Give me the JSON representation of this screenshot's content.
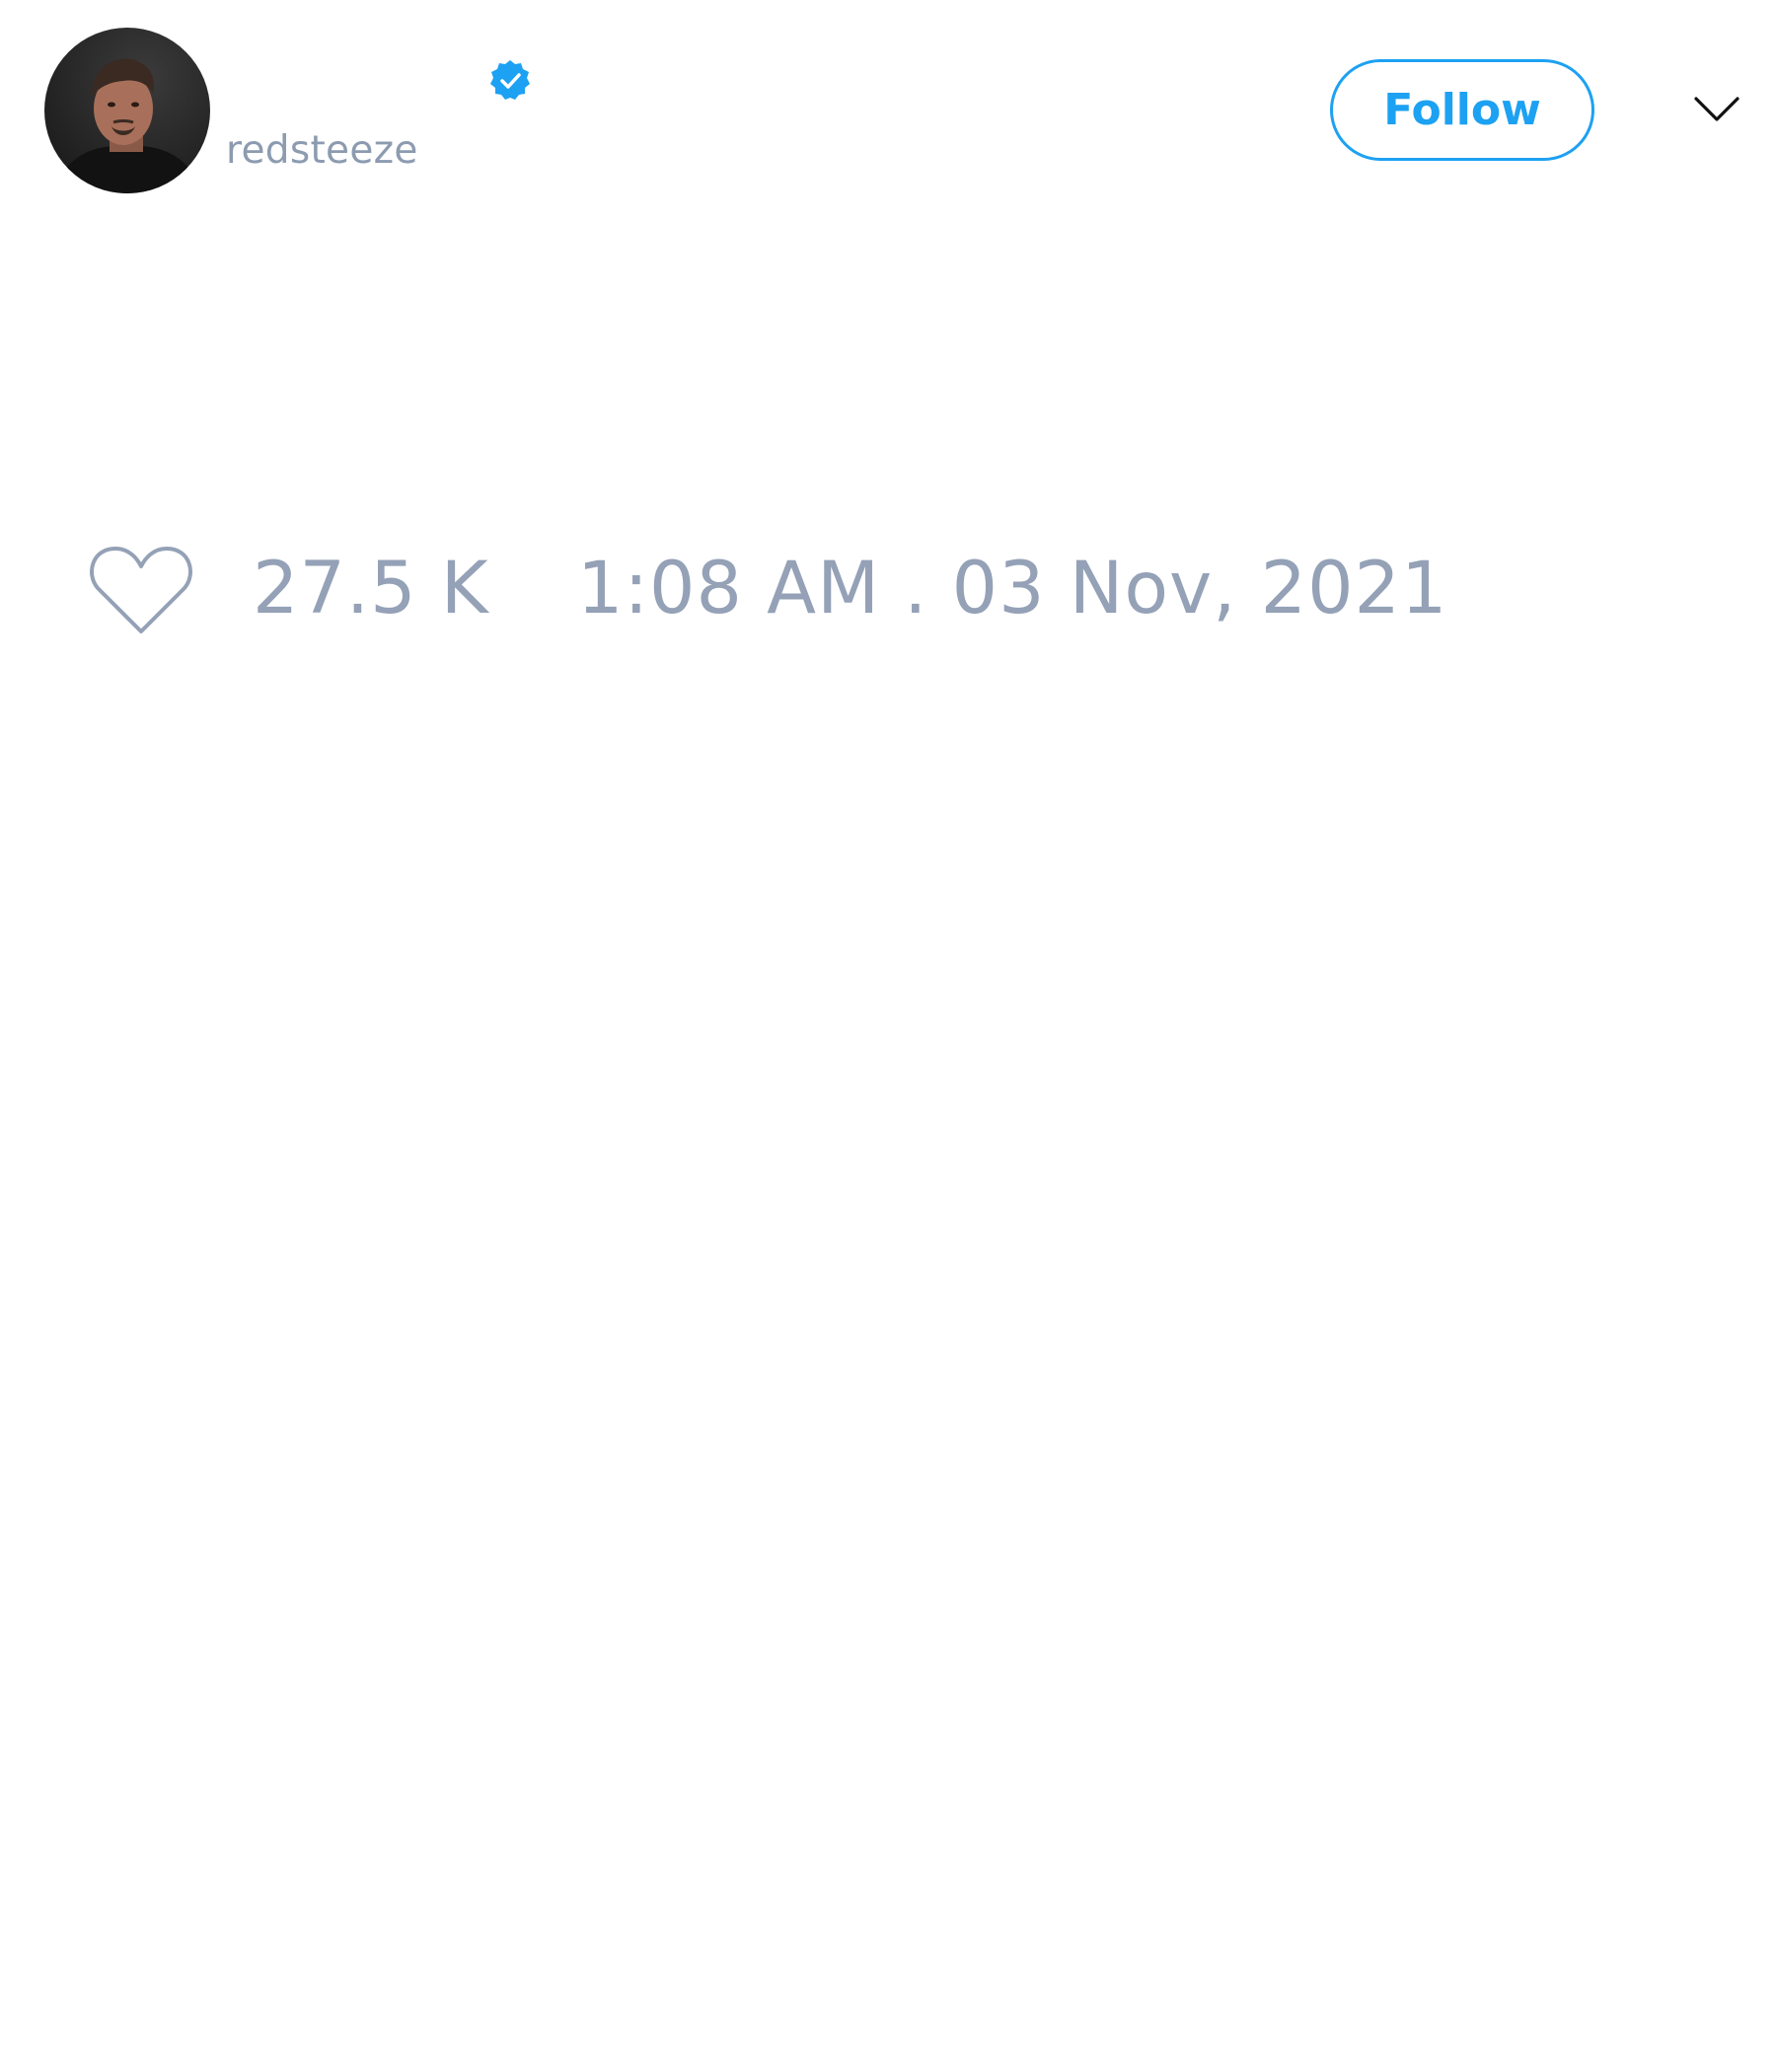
{
  "tweet": {
    "author": {
      "handle": "redsteeze",
      "verified": true,
      "avatar_icon": "user-avatar-photo"
    },
    "follow_label": "Follow",
    "menu_icon": "chevron-down-icon",
    "like_icon": "heart-outline-icon",
    "like_count": "27.5 K",
    "timestamp": "1:08 AM . 03 Nov, 2021"
  },
  "colors": {
    "accent": "#1da1f2",
    "muted_text": "#94a1b6",
    "background": "#ffffff"
  }
}
